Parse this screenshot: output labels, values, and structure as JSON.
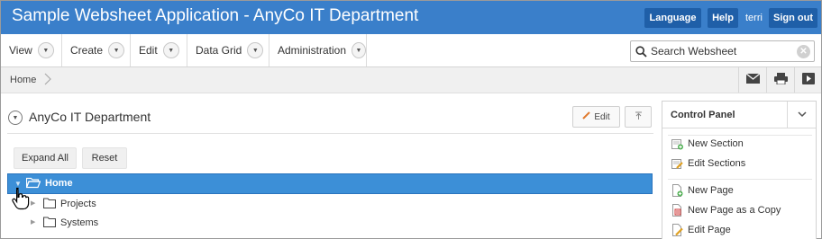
{
  "header": {
    "title": "Sample Websheet Application - AnyCo IT Department",
    "language_label": "Language",
    "help_label": "Help",
    "username": "terri",
    "signout_label": "Sign out"
  },
  "menubar": {
    "items": [
      {
        "label": "View"
      },
      {
        "label": "Create"
      },
      {
        "label": "Edit"
      },
      {
        "label": "Data Grid"
      },
      {
        "label": "Administration"
      }
    ],
    "search_placeholder": "Search Websheet"
  },
  "breadcrumb": {
    "current": "Home"
  },
  "toolbar": {
    "icons": [
      "email-icon",
      "print-icon",
      "presentation-icon"
    ]
  },
  "region": {
    "title": "AnyCo IT Department",
    "edit_label": "Edit",
    "expand_all_label": "Expand All",
    "reset_label": "Reset"
  },
  "tree": {
    "selected": {
      "label": "Home",
      "expanded": true
    },
    "children": [
      {
        "label": "Projects"
      },
      {
        "label": "Systems"
      }
    ]
  },
  "control_panel": {
    "title": "Control Panel",
    "items": [
      {
        "label": "New Section"
      },
      {
        "label": "Edit Sections"
      },
      {
        "label": "New Page"
      },
      {
        "label": "New Page as a Copy"
      },
      {
        "label": "Edit Page"
      }
    ]
  },
  "colors": {
    "header_bg": "#3a7fca",
    "header_button_bg": "#1f5fa8",
    "tree_selected_bg": "#3c8fd7"
  }
}
